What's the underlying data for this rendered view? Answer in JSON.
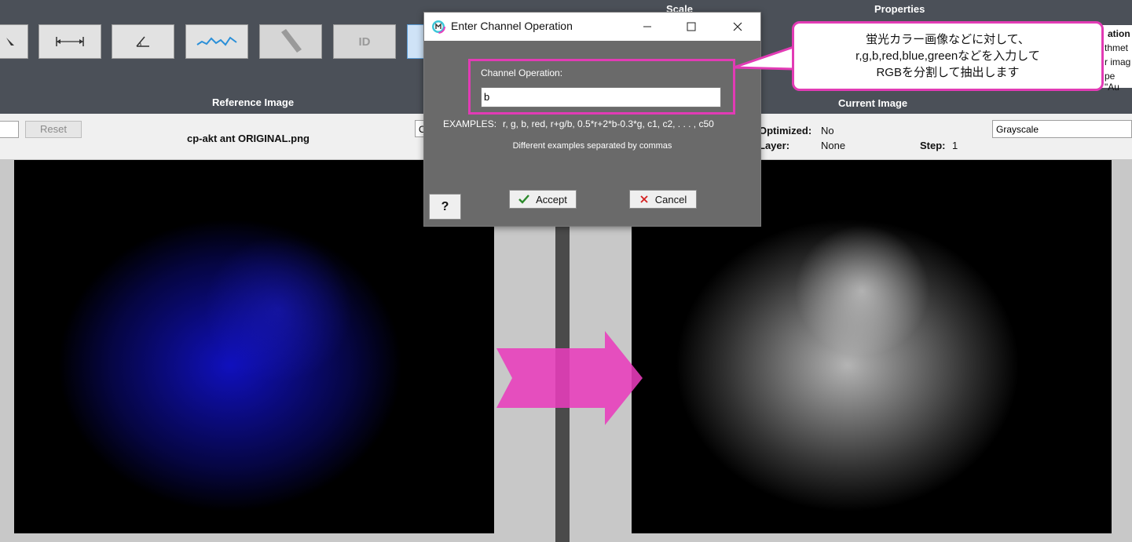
{
  "toolbar": {
    "scale_heading": "Scale",
    "properties_heading": "Properties",
    "id_label": "ID",
    "reference_label": "Reference Image",
    "current_label": "Current Image"
  },
  "properties_fragment": {
    "line1": "ation",
    "line2": "thmet",
    "line3": "r imag",
    "line4": "pe \"Au"
  },
  "reference": {
    "reset_label": "Reset",
    "filename": "cp-akt ant ORIGINAL.png",
    "select_fragment": "O"
  },
  "current": {
    "optimized_label": "Optimized:",
    "optimized_value": "No",
    "layer_label": "Layer:",
    "layer_value": "None",
    "step_label": "Step:",
    "step_value": "1",
    "mode_select": "Grayscale"
  },
  "dialog": {
    "title": "Enter Channel Operation",
    "field_label": "Channel Operation:",
    "field_value": "b",
    "examples_label": "EXAMPLES:",
    "examples": "r,  g,  b,  red,  r+g/b,  0.5*r+2*b-0.3*g,  c1, c2, . . . , c50",
    "separator_note": "Different examples separated by commas",
    "help_label": "?",
    "accept_label": "Accept",
    "cancel_label": "Cancel"
  },
  "callout": {
    "line1": "蛍光カラー画像などに対して、",
    "line2": "r,g,b,red,blue,greenなどを入力して",
    "line3": "RGBを分割して抽出します"
  },
  "colors": {
    "accent_pink": "#e23bb5",
    "toolbar_bg": "#4b5058",
    "dialog_body": "#6a6a6a"
  }
}
